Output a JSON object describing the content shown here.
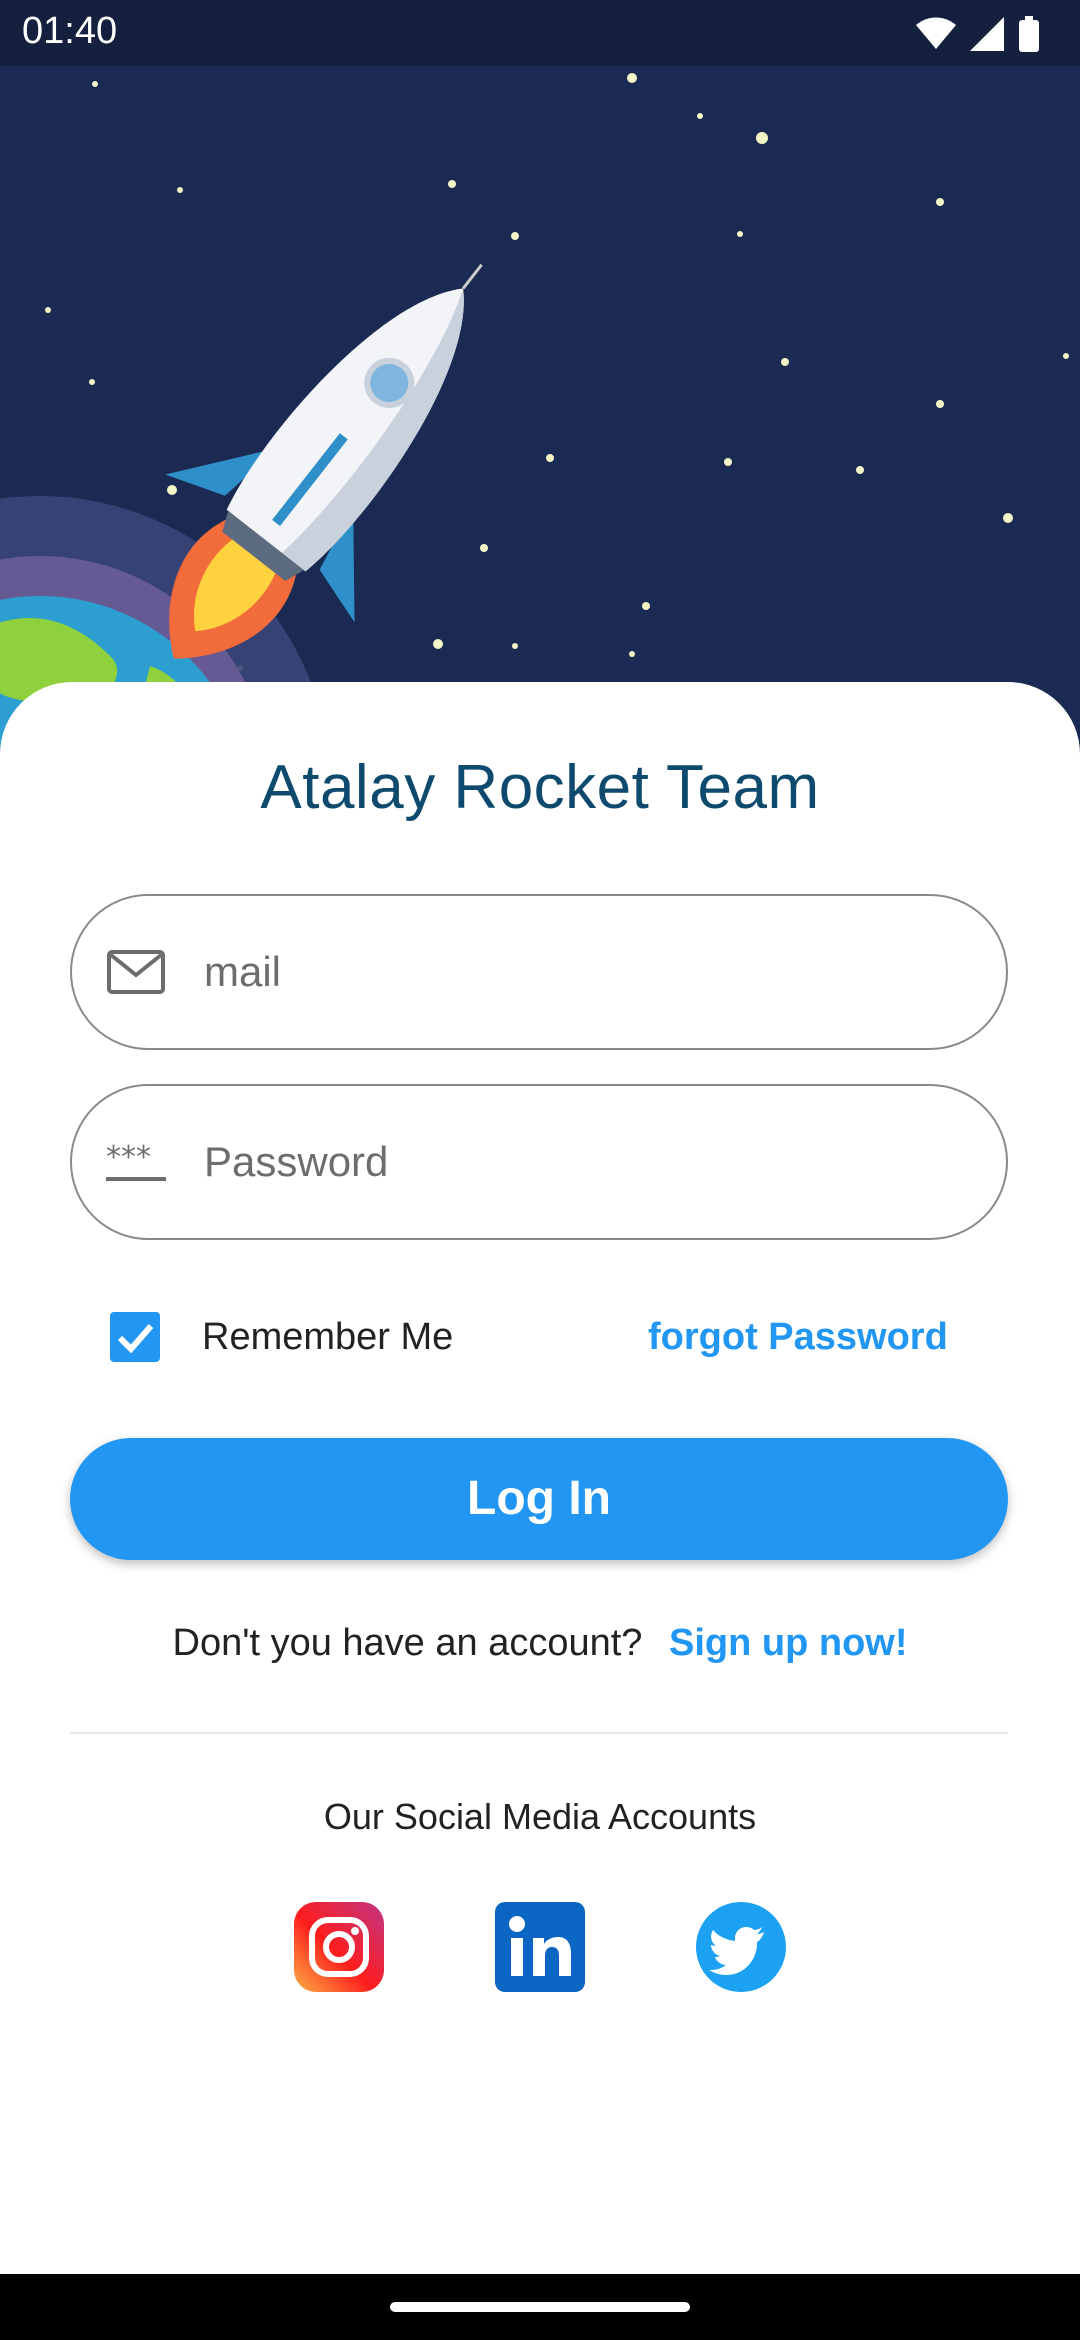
{
  "status_bar": {
    "time": "01:40",
    "icons": [
      "wifi-icon",
      "cell-signal-icon",
      "battery-icon"
    ]
  },
  "hero": {
    "illustration": "rocket-launch-illustration",
    "background_color": "#1a2a52"
  },
  "login": {
    "title": "Atalay Rocket Team",
    "email_placeholder": "mail",
    "password_placeholder": "Password",
    "remember_me_label": "Remember Me",
    "remember_me_checked": true,
    "forgot_password_label": "forgot Password",
    "login_button_label": "Log In",
    "signup_prompt": "Don't you have an account?",
    "signup_link": "Sign up now!"
  },
  "social": {
    "title": "Our Social Media Accounts",
    "accounts": [
      "instagram-icon",
      "linkedin-icon",
      "twitter-icon"
    ]
  },
  "colors": {
    "accent": "#2196f3",
    "title": "#0d4a6e",
    "hero_bg": "#1a2a52"
  }
}
